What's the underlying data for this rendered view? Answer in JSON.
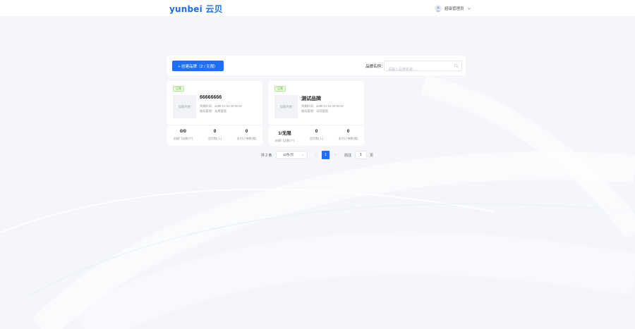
{
  "header": {
    "logo": "yunbei 云贝",
    "user_name": "超级管理员"
  },
  "toolbar": {
    "create_label": "+ 创建品牌（2 / 无限）",
    "filter_label": "品牌名称：",
    "search_placeholder": "请输入品牌名称"
  },
  "cards": [
    {
      "tag": "正常",
      "thumb_text": "加载失败",
      "title": "66666666",
      "expire": "到期时间：2099-01-01 00:00:00",
      "manager": "服务管理：无需管理",
      "stats": [
        {
          "value": "0/0",
          "label": "创建门店数(个)"
        },
        {
          "value": "0",
          "label": "会员数(人)"
        },
        {
          "value": "0",
          "label": "支付订单数(笔)"
        }
      ]
    },
    {
      "tag": "正常",
      "thumb_text": "加载失败",
      "title": "测试品牌",
      "expire": "到期时间：2099-01-01 00:00:00",
      "manager": "服务管理：试用管理",
      "stats": [
        {
          "value": "1/无限",
          "label": "创建门店数(个)"
        },
        {
          "value": "0",
          "label": "会员数(人)"
        },
        {
          "value": "0",
          "label": "支付订单数(笔)"
        }
      ]
    }
  ],
  "pagination": {
    "total": "共 2 条",
    "page_size": "10条/页",
    "current": "1",
    "goto_label": "前往",
    "goto_value": "1",
    "page_suffix": "页"
  },
  "colors": {
    "primary": "#1f6ff5",
    "logo": "#1a6cf0",
    "tag_green": "#52a82a",
    "background": "#f4f6fa"
  }
}
